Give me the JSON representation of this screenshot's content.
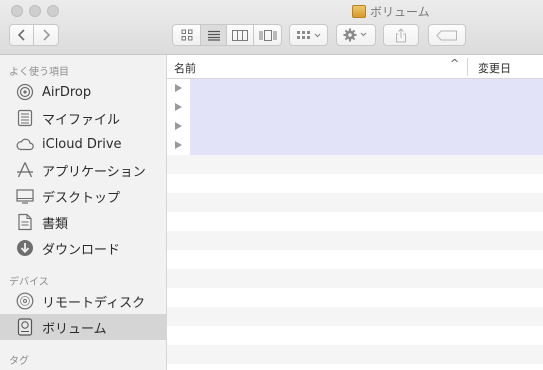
{
  "window": {
    "title": "ボリューム"
  },
  "toolbar": {
    "nav": [
      "chevron-left-icon",
      "chevron-right-icon"
    ],
    "view_modes": [
      "icon-view-icon",
      "list-view-icon",
      "column-view-icon",
      "coverflow-view-icon"
    ],
    "active_view": "list-view-icon",
    "arrange": "arrange-icon",
    "action": "gear-icon",
    "share": "share-icon",
    "tag": "tag-icon"
  },
  "sidebar": {
    "favorites_header": "よく使う項目",
    "favorites": [
      {
        "label": "AirDrop",
        "icon": "airdrop-icon"
      },
      {
        "label": "マイファイル",
        "icon": "all-files-icon"
      },
      {
        "label": "iCloud Drive",
        "icon": "cloud-icon"
      },
      {
        "label": "アプリケーション",
        "icon": "applications-icon"
      },
      {
        "label": "デスクトップ",
        "icon": "desktop-icon"
      },
      {
        "label": "書類",
        "icon": "documents-icon"
      },
      {
        "label": "ダウンロード",
        "icon": "download-icon"
      }
    ],
    "devices_header": "デバイス",
    "devices": [
      {
        "label": "リモートディスク",
        "icon": "remote-disc-icon"
      },
      {
        "label": "ボリューム",
        "icon": "drive-icon",
        "selected": true
      }
    ],
    "tags_header": "タグ"
  },
  "list": {
    "columns": {
      "name": "名前",
      "sort_indicator": "^",
      "modified": "変更日"
    },
    "expandable_rows": 4
  },
  "colors": {
    "selection": "#e2e2f9",
    "sidebar_bg": "#f2f2f2",
    "sidebar_selected": "#d5d5d5"
  }
}
